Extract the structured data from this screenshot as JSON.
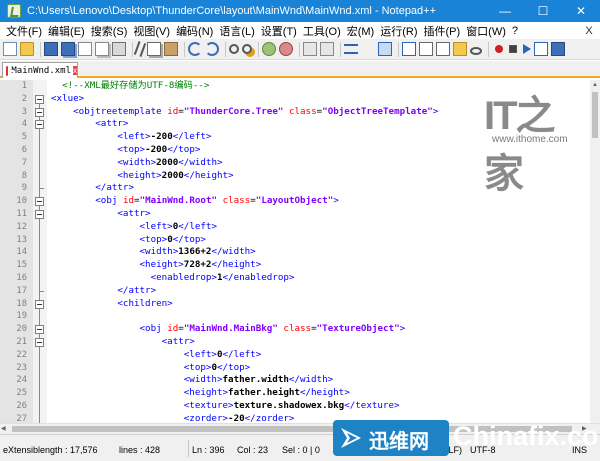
{
  "window": {
    "title": "C:\\Users\\Lenovo\\Desktop\\ThunderCore\\layout\\MainWnd\\MainWnd.xml - Notepad++",
    "minimize_glyph": "—",
    "maximize_glyph": "☐",
    "close_glyph": "✕",
    "titlebar_color": "#1883d7"
  },
  "menu": {
    "items": [
      "文件(F)",
      "编辑(E)",
      "搜索(S)",
      "视图(V)",
      "编码(N)",
      "语言(L)",
      "设置(T)",
      "工具(O)",
      "宏(M)",
      "运行(R)",
      "插件(P)",
      "窗口(W)",
      "?"
    ],
    "close_glyph": "X"
  },
  "toolbar": {
    "icons": [
      "new-file-icon",
      "open-file-icon",
      "save-icon",
      "save-all-icon",
      "close-file-icon",
      "close-all-icon",
      "print-icon",
      "cut-icon",
      "copy-icon",
      "paste-icon",
      "undo-icon",
      "redo-icon",
      "find-icon",
      "replace-icon",
      "zoom-in-icon",
      "zoom-out-icon",
      "sync-vertical-icon",
      "sync-horizontal-icon",
      "word-wrap-icon",
      "show-all-chars-icon",
      "indent-guide-icon",
      "user-language-icon",
      "document-map-icon",
      "function-list-icon",
      "folder-workspace-icon",
      "monitoring-icon",
      "record-macro-icon",
      "stop-macro-icon",
      "play-macro-icon",
      "run-macro-multiple-icon",
      "save-macro-icon"
    ]
  },
  "tab": {
    "label": "MainWnd.xml",
    "close_glyph": "x",
    "accent_color": "#f4a81d"
  },
  "editor": {
    "lines": [
      {
        "n": "1",
        "indent": "  ",
        "parts": [
          {
            "c": "t-cmt",
            "t": "<!--XML最好存储为UTF-8编码-->"
          }
        ]
      },
      {
        "n": "2",
        "indent": "",
        "parts": [
          {
            "c": "t-tag",
            "t": "<xlue>"
          }
        ]
      },
      {
        "n": "3",
        "indent": "    ",
        "parts": [
          {
            "c": "t-tag",
            "t": "<objtreetemplate "
          },
          {
            "c": "t-attr",
            "t": "id"
          },
          {
            "c": "t-eq",
            "t": "="
          },
          {
            "c": "t-val",
            "t": "\"ThunderCore.Tree\""
          },
          {
            "c": "t-eq",
            "t": " "
          },
          {
            "c": "t-attr",
            "t": "class"
          },
          {
            "c": "t-eq",
            "t": "="
          },
          {
            "c": "t-val",
            "t": "\"ObjectTreeTemplate\""
          },
          {
            "c": "t-tag",
            "t": ">"
          }
        ]
      },
      {
        "n": "4",
        "indent": "        ",
        "parts": [
          {
            "c": "t-tag",
            "t": "<attr>"
          }
        ]
      },
      {
        "n": "5",
        "indent": "            ",
        "parts": [
          {
            "c": "t-tag",
            "t": "<left>"
          },
          {
            "c": "t-txt",
            "t": "-200"
          },
          {
            "c": "t-tag",
            "t": "</left>"
          }
        ]
      },
      {
        "n": "6",
        "indent": "            ",
        "parts": [
          {
            "c": "t-tag",
            "t": "<top>"
          },
          {
            "c": "t-txt",
            "t": "-200"
          },
          {
            "c": "t-tag",
            "t": "</top>"
          }
        ]
      },
      {
        "n": "7",
        "indent": "            ",
        "parts": [
          {
            "c": "t-tag",
            "t": "<width>"
          },
          {
            "c": "t-txt",
            "t": "2000"
          },
          {
            "c": "t-tag",
            "t": "</width>"
          }
        ]
      },
      {
        "n": "8",
        "indent": "            ",
        "parts": [
          {
            "c": "t-tag",
            "t": "<height>"
          },
          {
            "c": "t-txt",
            "t": "2000"
          },
          {
            "c": "t-tag",
            "t": "</height>"
          }
        ]
      },
      {
        "n": "9",
        "indent": "        ",
        "parts": [
          {
            "c": "t-tag",
            "t": "</attr>"
          }
        ]
      },
      {
        "n": "10",
        "indent": "        ",
        "parts": [
          {
            "c": "t-tag",
            "t": "<obj "
          },
          {
            "c": "t-attr",
            "t": "id"
          },
          {
            "c": "t-eq",
            "t": "="
          },
          {
            "c": "t-val",
            "t": "\"MainWnd.Root\""
          },
          {
            "c": "t-eq",
            "t": " "
          },
          {
            "c": "t-attr",
            "t": "class"
          },
          {
            "c": "t-eq",
            "t": "="
          },
          {
            "c": "t-val",
            "t": "\"LayoutObject\""
          },
          {
            "c": "t-tag",
            "t": ">"
          }
        ]
      },
      {
        "n": "11",
        "indent": "            ",
        "parts": [
          {
            "c": "t-tag",
            "t": "<attr>"
          }
        ]
      },
      {
        "n": "12",
        "indent": "                ",
        "parts": [
          {
            "c": "t-tag",
            "t": "<left>"
          },
          {
            "c": "t-txt",
            "t": "0"
          },
          {
            "c": "t-tag",
            "t": "</left>"
          }
        ]
      },
      {
        "n": "13",
        "indent": "                ",
        "parts": [
          {
            "c": "t-tag",
            "t": "<top>"
          },
          {
            "c": "t-txt",
            "t": "0"
          },
          {
            "c": "t-tag",
            "t": "</top>"
          }
        ]
      },
      {
        "n": "14",
        "indent": "                ",
        "parts": [
          {
            "c": "t-tag",
            "t": "<width>"
          },
          {
            "c": "t-txt",
            "t": "1366+2"
          },
          {
            "c": "t-tag",
            "t": "</width>"
          }
        ]
      },
      {
        "n": "15",
        "indent": "                ",
        "parts": [
          {
            "c": "t-tag",
            "t": "<height>"
          },
          {
            "c": "t-txt",
            "t": "728+2"
          },
          {
            "c": "t-tag",
            "t": "</height>"
          }
        ]
      },
      {
        "n": "16",
        "indent": "                  ",
        "parts": [
          {
            "c": "t-tag",
            "t": "<enabledrop>"
          },
          {
            "c": "t-txt",
            "t": "1"
          },
          {
            "c": "t-tag",
            "t": "</enabledrop>"
          }
        ]
      },
      {
        "n": "17",
        "indent": "            ",
        "parts": [
          {
            "c": "t-tag",
            "t": "</attr>"
          }
        ]
      },
      {
        "n": "18",
        "indent": "            ",
        "parts": [
          {
            "c": "t-tag",
            "t": "<children>"
          }
        ]
      },
      {
        "n": "19",
        "indent": "",
        "parts": []
      },
      {
        "n": "20",
        "indent": "                ",
        "parts": [
          {
            "c": "t-tag",
            "t": "<obj "
          },
          {
            "c": "t-attr",
            "t": "id"
          },
          {
            "c": "t-eq",
            "t": "="
          },
          {
            "c": "t-val",
            "t": "\"MainWnd.MainBkg\""
          },
          {
            "c": "t-eq",
            "t": " "
          },
          {
            "c": "t-attr",
            "t": "class"
          },
          {
            "c": "t-eq",
            "t": "="
          },
          {
            "c": "t-val",
            "t": "\"TextureObject\""
          },
          {
            "c": "t-tag",
            "t": ">"
          }
        ]
      },
      {
        "n": "21",
        "indent": "                    ",
        "parts": [
          {
            "c": "t-tag",
            "t": "<attr>"
          }
        ]
      },
      {
        "n": "22",
        "indent": "                        ",
        "parts": [
          {
            "c": "t-tag",
            "t": "<left>"
          },
          {
            "c": "t-txt",
            "t": "0"
          },
          {
            "c": "t-tag",
            "t": "</left>"
          }
        ]
      },
      {
        "n": "23",
        "indent": "                        ",
        "parts": [
          {
            "c": "t-tag",
            "t": "<top>"
          },
          {
            "c": "t-txt",
            "t": "0"
          },
          {
            "c": "t-tag",
            "t": "</top>"
          }
        ]
      },
      {
        "n": "24",
        "indent": "                        ",
        "parts": [
          {
            "c": "t-tag",
            "t": "<width>"
          },
          {
            "c": "t-txt",
            "t": "father.width"
          },
          {
            "c": "t-tag",
            "t": "</width>"
          }
        ]
      },
      {
        "n": "25",
        "indent": "                        ",
        "parts": [
          {
            "c": "t-tag",
            "t": "<height>"
          },
          {
            "c": "t-txt",
            "t": "father.height"
          },
          {
            "c": "t-tag",
            "t": "</height>"
          }
        ]
      },
      {
        "n": "26",
        "indent": "                        ",
        "parts": [
          {
            "c": "t-tag",
            "t": "<texture>"
          },
          {
            "c": "t-txt",
            "t": "texture.shadowex.bkg"
          },
          {
            "c": "t-tag",
            "t": "</texture>"
          }
        ]
      },
      {
        "n": "27",
        "indent": "                        ",
        "parts": [
          {
            "c": "t-tag",
            "t": "<zorder>"
          },
          {
            "c": "t-txt",
            "t": "-20"
          },
          {
            "c": "t-tag",
            "t": "</zorder>"
          }
        ]
      }
    ],
    "fold_boxes": [
      "2",
      "3",
      "4",
      "10",
      "11",
      "18",
      "20",
      "21"
    ],
    "fold_ends": [
      "9",
      "17"
    ]
  },
  "statusbar": {
    "file_type": "eXtensib",
    "length": "length : 17,576",
    "lines": "lines : 428",
    "ln": "Ln : 396",
    "col": "Col : 23",
    "sel": "Sel : 0 | 0",
    "eol": "Windows (CR LF)",
    "encoding": "UTF-8",
    "mode": "INS"
  },
  "watermarks": {
    "ithome_logo": "IT之家",
    "ithome_site": "www.ithome.com",
    "chinafix_badge": "迅维网",
    "chinafix_brand": "Chinafix.com"
  }
}
